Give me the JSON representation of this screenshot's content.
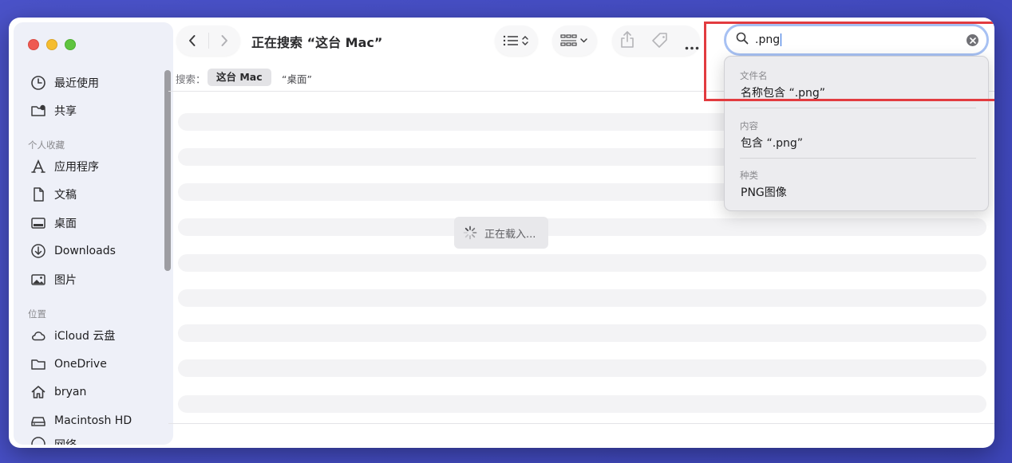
{
  "window": {
    "title": "正在搜索 “这台 Mac”"
  },
  "sidebar": {
    "recents": {
      "label": "最近使用",
      "icon": "clock-icon"
    },
    "shared": {
      "label": "共享",
      "icon": "shared-folder-icon"
    },
    "favorites_header": "个人收藏",
    "favorites": [
      {
        "label": "应用程序",
        "icon": "applications-icon"
      },
      {
        "label": "文稿",
        "icon": "document-icon"
      },
      {
        "label": "桌面",
        "icon": "desktop-icon"
      },
      {
        "label": "Downloads",
        "icon": "download-icon"
      },
      {
        "label": "图片",
        "icon": "photo-icon"
      }
    ],
    "locations_header": "位置",
    "locations": [
      {
        "label": "iCloud 云盘",
        "icon": "cloud-icon"
      },
      {
        "label": "OneDrive",
        "icon": "folder-icon"
      },
      {
        "label": "bryan",
        "icon": "home-icon"
      },
      {
        "label": "Macintosh HD",
        "icon": "disk-icon"
      },
      {
        "label": "网络",
        "icon": "network-icon"
      }
    ]
  },
  "toolbar": {
    "back_icon": "chevron-left-icon",
    "forward_icon": "chevron-right-icon",
    "view_icon": "list-view-icon",
    "group_icon": "grid-group-icon",
    "share_icon": "share-icon",
    "tag_icon": "tag-icon",
    "more_icon": "ellipsis-icon"
  },
  "search": {
    "value": ".png",
    "icon": "search-icon",
    "clear_icon": "clear-icon"
  },
  "scope": {
    "label": "搜索：",
    "active": "这台 Mac",
    "other": "“桌面”"
  },
  "loading": {
    "text": "正在载入..."
  },
  "suggestions": {
    "filename_header": "文件名",
    "filename_item": "名称包含 “.png”",
    "content_header": "内容",
    "content_item": "包含 “.png”",
    "kind_header": "种类",
    "kind_item": "PNG图像"
  },
  "colors": {
    "background": "#4a52c8",
    "highlight": "#e23b3f",
    "search_ring": "#a7c1f3"
  }
}
